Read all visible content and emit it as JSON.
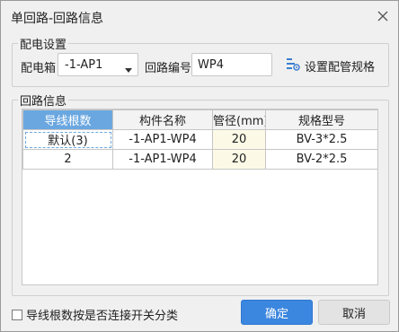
{
  "window": {
    "title": "单回路-回路信息"
  },
  "config": {
    "legend": "配电设置",
    "panel_label": "配电箱",
    "panel_value": "-1-AP1",
    "circuit_label": "回路编号",
    "circuit_value": "WP4",
    "pipe_spec_button": "设置配管规格"
  },
  "info": {
    "legend": "回路信息",
    "columns": [
      "导线根数",
      "构件名称",
      "管径(mm)",
      "规格型号"
    ],
    "rows": [
      [
        "默认(3)",
        "-1-AP1-WP4",
        "20",
        "BV-3*2.5"
      ],
      [
        "2",
        "-1-AP1-WP4",
        "20",
        "BV-2*2.5"
      ]
    ]
  },
  "footer": {
    "classify_checkbox_label": "导线根数按是否连接开关分类",
    "classify_checked": false,
    "ok_label": "确定",
    "cancel_label": "取消"
  },
  "colors": {
    "primary": "#3b86df",
    "header_selected": "#6aa7e0",
    "highlight_cell": "#fcfae6"
  },
  "icons": {
    "close": "close-icon",
    "dropdown": "chevron-down-icon",
    "pipe_settings": "pipe-settings-icon"
  }
}
